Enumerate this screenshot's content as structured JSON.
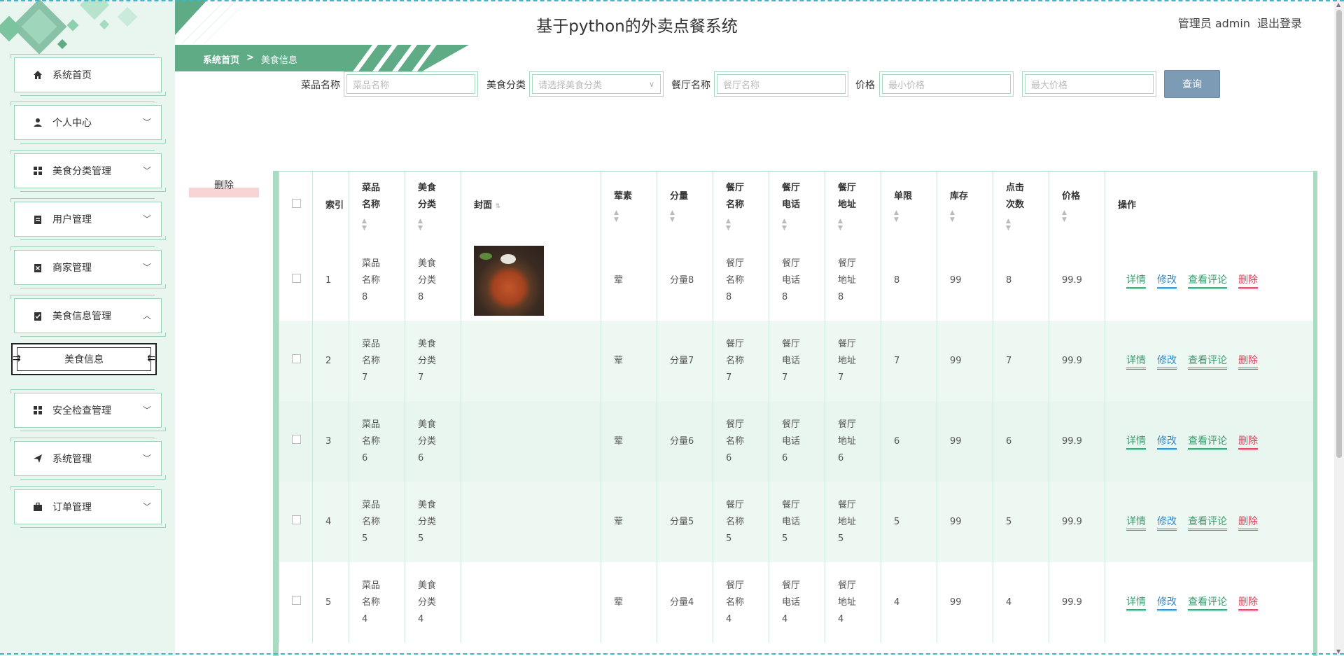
{
  "header": {
    "title": "基于python的外卖点餐系统",
    "user_label": "管理员 admin",
    "logout": "退出登录"
  },
  "breadcrumb": {
    "home": "系统首页",
    "separator": ">",
    "current": "美食信息"
  },
  "sidebar": {
    "items": [
      {
        "label": "系统首页",
        "icon": "home-icon"
      },
      {
        "label": "个人中心",
        "icon": "user-icon"
      },
      {
        "label": "美食分类管理",
        "icon": "grid-icon"
      },
      {
        "label": "用户管理",
        "icon": "clipboard-icon"
      },
      {
        "label": "商家管理",
        "icon": "clipboard-x-icon"
      },
      {
        "label": "美食信息管理",
        "icon": "clipboard-check-icon"
      },
      {
        "label": "安全检查管理",
        "icon": "grid-icon"
      },
      {
        "label": "系统管理",
        "icon": "send-icon"
      },
      {
        "label": "订单管理",
        "icon": "briefcase-icon"
      }
    ],
    "active_sub": "美食信息"
  },
  "search": {
    "dish_label": "菜品名称",
    "dish_placeholder": "菜品名称",
    "cat_label": "美食分类",
    "cat_placeholder": "请选择美食分类",
    "rest_label": "餐厅名称",
    "rest_placeholder": "餐厅名称",
    "price_label": "价格",
    "min_placeholder": "最小价格",
    "max_placeholder": "最大价格",
    "query": "查询"
  },
  "delete_button": "删除",
  "table": {
    "headers": {
      "index": "索引",
      "dish": "菜品名称",
      "cat": "美食分类",
      "cover": "封面",
      "veg": "荤素",
      "portion": "分量",
      "rest_name": "餐厅名称",
      "rest_phone": "餐厅电话",
      "rest_addr": "餐厅地址",
      "limit": "单限",
      "stock": "库存",
      "clicks": "点击次数",
      "price": "价格",
      "ops": "操作"
    },
    "ops": {
      "detail": "详情",
      "edit": "修改",
      "comment": "查看评论",
      "delete": "删除"
    },
    "rows": [
      {
        "index": "1",
        "dish": "菜品名称8",
        "cat": "美食分类8",
        "veg": "荤",
        "portion": "分量8",
        "rest_name": "餐厅名称8",
        "rest_phone": "餐厅电话8",
        "rest_addr": "餐厅地址8",
        "limit": "8",
        "stock": "99",
        "clicks": "8",
        "price": "99.9"
      },
      {
        "index": "2",
        "dish": "菜品名称7",
        "cat": "美食分类7",
        "veg": "荤",
        "portion": "分量7",
        "rest_name": "餐厅名称7",
        "rest_phone": "餐厅电话7",
        "rest_addr": "餐厅地址7",
        "limit": "7",
        "stock": "99",
        "clicks": "7",
        "price": "99.9"
      },
      {
        "index": "3",
        "dish": "菜品名称6",
        "cat": "美食分类6",
        "veg": "荤",
        "portion": "分量6",
        "rest_name": "餐厅名称6",
        "rest_phone": "餐厅电话6",
        "rest_addr": "餐厅地址6",
        "limit": "6",
        "stock": "99",
        "clicks": "6",
        "price": "99.9"
      },
      {
        "index": "4",
        "dish": "菜品名称5",
        "cat": "美食分类5",
        "veg": "荤",
        "portion": "分量5",
        "rest_name": "餐厅名称5",
        "rest_phone": "餐厅电话5",
        "rest_addr": "餐厅地址5",
        "limit": "5",
        "stock": "99",
        "clicks": "5",
        "price": "99.9"
      },
      {
        "index": "5",
        "dish": "菜品名称4",
        "cat": "美食分类4",
        "veg": "荤",
        "portion": "分量4",
        "rest_name": "餐厅名称4",
        "rest_phone": "餐厅电话4",
        "rest_addr": "餐厅地址4",
        "limit": "4",
        "stock": "99",
        "clicks": "4",
        "price": "99.9"
      }
    ]
  },
  "colors": {
    "accent": "#5eab86",
    "sidebar_bg": "#e9f6f0",
    "query_btn": "#7e9bb6",
    "delete": "#d8425a",
    "edit": "#2f86c9"
  }
}
